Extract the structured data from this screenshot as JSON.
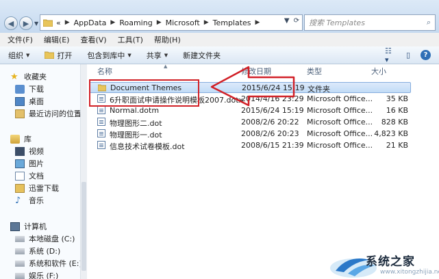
{
  "address": {
    "overflow": "«",
    "crumbs": [
      "AppData",
      "Roaming",
      "Microsoft",
      "Templates"
    ],
    "search_placeholder": "搜索 Templates"
  },
  "menu": [
    "文件(F)",
    "编辑(E)",
    "查看(V)",
    "工具(T)",
    "帮助(H)"
  ],
  "commands": {
    "organize": "组织",
    "open": "打开",
    "include_in_library": "包含到库中",
    "share": "共享",
    "new_folder": "新建文件夹"
  },
  "nav": {
    "favorites_header": "收藏夹",
    "favorites": [
      "下载",
      "桌面",
      "最近访问的位置"
    ],
    "libraries_header": "库",
    "libraries": [
      "视频",
      "图片",
      "文档",
      "迅雷下载",
      "音乐"
    ],
    "computer_header": "计算机",
    "drives": [
      "本地磁盘 (C:)",
      "系统 (D:)",
      "系统和软件 (E:)",
      "娱乐 (F:)"
    ]
  },
  "columns": {
    "name": "名称",
    "modified": "修改日期",
    "type": "类型",
    "size": "大小"
  },
  "files": [
    {
      "name": "Document Themes",
      "modified": "2015/6/24 15:19",
      "type": "文件夹",
      "size": "",
      "icon": "folder-icon",
      "selected": true
    },
    {
      "name": "6升职面试申请操作说明模板2007.dotx",
      "modified": "2014/4/16 23:29",
      "type": "Microsoft Office...",
      "size": "35 KB",
      "icon": "template-icon"
    },
    {
      "name": "Normal.dotm",
      "modified": "2015/6/24 15:19",
      "type": "Microsoft Office...",
      "size": "16 KB",
      "icon": "template-icon"
    },
    {
      "name": "物理图形二.dot",
      "modified": "2008/2/6 20:22",
      "type": "Microsoft Office...",
      "size": "828 KB",
      "icon": "template-icon"
    },
    {
      "name": "物理图形一.dot",
      "modified": "2008/2/6 20:23",
      "type": "Microsoft Office...",
      "size": "4,823 KB",
      "icon": "template-icon"
    },
    {
      "name": "信息技术试卷模板.dot",
      "modified": "2008/6/15 21:39",
      "type": "Microsoft Office...",
      "size": "21 KB",
      "icon": "template-icon"
    }
  ],
  "watermark": {
    "text": "系统之家",
    "url": "www.xitongzhijia.net"
  },
  "colors": {
    "accent": "#2f6fb6",
    "annotation": "#d11f26",
    "selection": "#c2dcf6"
  }
}
